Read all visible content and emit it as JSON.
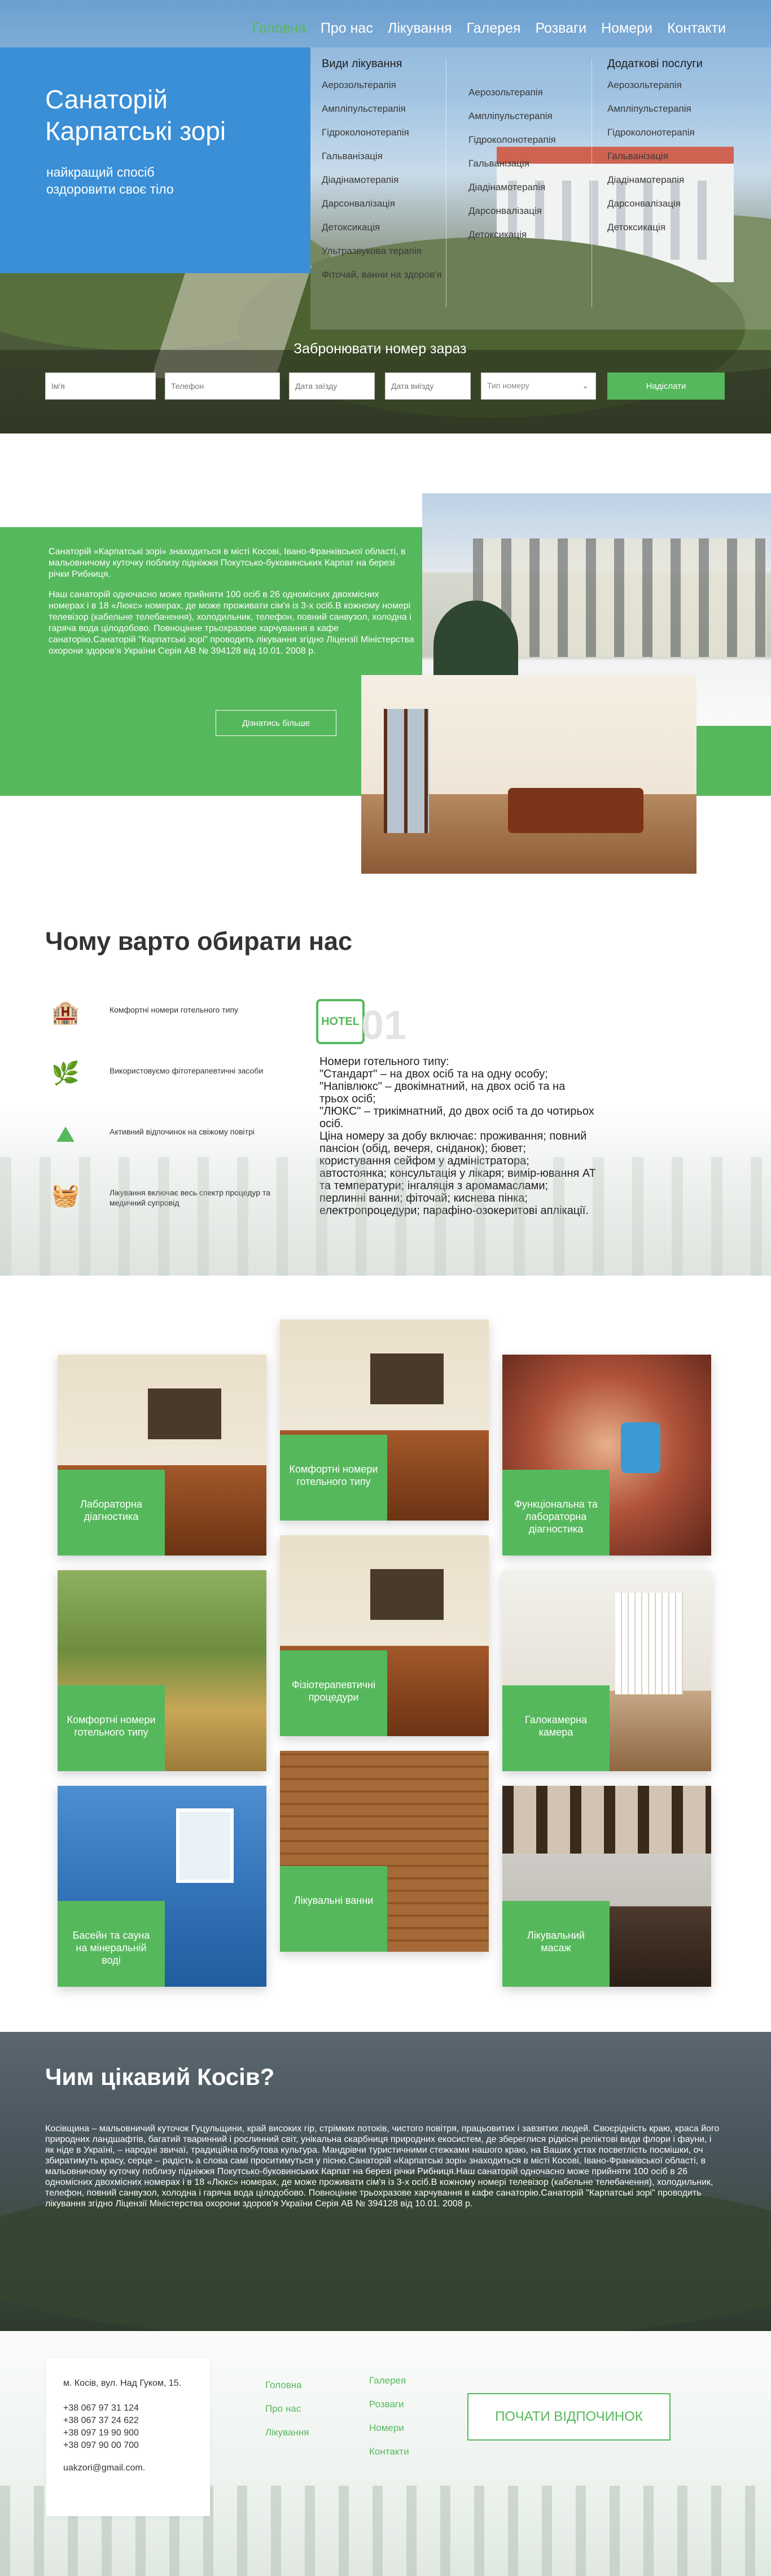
{
  "nav": [
    "Головна",
    "Про нас",
    "Лікування",
    "Галерея",
    "Розваги",
    "Номери",
    "Контакти"
  ],
  "hero": {
    "title": "Санаторій\nКарпатські зорі",
    "subtitle": "найкращий спосіб\nоздоровити своє тіло"
  },
  "treatment_menu": {
    "col1_title": "Види лікування",
    "col1": [
      "Аерозольтерапія",
      "Ампліпульстерапія",
      "Гідроколонотерапія",
      "Гальванізація",
      "Діадінамотерапія",
      "Дарсонвалізація",
      "Детоксикація",
      "Ультразвукова терапія",
      "Фіточай, ванни на здоров'я"
    ],
    "col2": [
      "Аерозольтерапія",
      "Ампліпульстерапія",
      "Гідроколонотерапія",
      "Гальванізація",
      "Діадінамотерапія",
      "Дарсонвалізація",
      "Детоксикація"
    ],
    "col3_title": "Додаткові послуги",
    "col3": [
      "Аерозольтерапія",
      "Ампліпульстерапія",
      "Гідроколонотерапія",
      "Гальванізація",
      "Діадінамотерапія",
      "Дарсонвалізація",
      "Детоксикація"
    ]
  },
  "booking": {
    "title": "Забронювати номер зараз",
    "name_placeholder": "Ім'я",
    "phone_placeholder": "Телефон",
    "date_in_placeholder": "Дата заїзду",
    "date_out_placeholder": "Дата виїзду",
    "type_placeholder": "Тип номеру",
    "submit": "Надіслати"
  },
  "about": {
    "p1": "Санаторій «Карпатські зорі» знаходиться в місті Косові, Івано-Франківської області, в мальовничому куточку поблизу підніжжя Покутсько-буковинських Карпат на березі річки Рибниця.",
    "p2": "Наш санаторій одночасно може прийняти 100 осіб в 26 одномісних двохмісних номерах і в 18 «Люкс» номерах, де може проживати сім'я із 3-х осіб.В кожному номері телевізор (кабельне телебачення), холодильник, телефон, повний санвузол, холодна і гаряча вода цілодобово. Повноцінне трьохразове харчування в кафе санаторію.Санаторій \"Карпатські зорі\" проводить лікування згідно Ліцензії Міністерства охорони здоров'я України Серія АВ № 394128 від 10.01. 2008 р.",
    "button": "Дізнатись більше"
  },
  "why": {
    "title": "Чому варто обирати нас",
    "items": [
      {
        "icon": "hotel-icon",
        "text": "Комфортні номери готельного типу"
      },
      {
        "icon": "leaf-icon",
        "text": "Використовуємо фітотерапевтичні засоби"
      },
      {
        "icon": "mountain-icon",
        "text": "Активний відпочинок на свіжому повітрі"
      },
      {
        "icon": "basket-icon",
        "text": "Лікування включає весь спектр процедур та медичний супровід"
      }
    ],
    "big_icon_label": "HOTEL",
    "number": "01",
    "detail": "Номери готельного типу:\n\"Стандарт\" – на двох осіб та на одну особу;\n\"Напівлюкс\" – двокімнатний, на двох осіб та на трьох осіб;\n\"ЛЮКС\" – трикімнатний, до двох осіб та до чотирьох осіб.\nЦіна номеру за добу включає: проживання; повний пансіон (обід, вечеря, сніданок); бювет; користування сейфом у адміністратора; автостоянка; консультація у лікаря; вимір-ювання АТ та температури; інгаляція з аромамаслами; перлинні ванни; фіточай; киснева пінка; електропроцедури; парафіно-озокеритові аплікації."
  },
  "gallery": [
    "Лабораторна діагностика",
    "Комфортні номери готельного типу",
    "Функціональна та лабораторна діагностика",
    "Комфортні номери готельного типу",
    "Фізіотерапевтичні процедури",
    "Галокамерна камера",
    "Басейн та сауна на мінеральній воді",
    "Лікувальні ванни",
    "Лікувальний масаж"
  ],
  "kosiv": {
    "title": "Чим цікавий Косів?",
    "text": "Косівщина – мальовничий куточок Гуцульщини, край високих гір, стрімких потоків, чистого повітря, працьовитих і завзятих людей. Своєрідність краю, краса його природних ландшафтів, багатий тваринний і рослинний світ, унікальна скарбниця природних екосистем, де збереглися рідкісні реліктові види флори і фауни, і як ніде в Україні, – народні звичаї, традиційна побутова культура. Мандрівчи туристичними стежками нашого краю, на Ваших устах посветлість посмішки, оч збиратимуть красу, серце – радість а слова самі проситимуться у пісню.Санаторій «Карпатські зорі» знаходиться в місті Косові, Івано-Франківської області, в мальовничому куточку поблизу підніжжя Покутсько-буковинських Карпат на березі річки Рибниця.Наш санаторій одночасно може прийняти 100 осіб в 26 одномісних двохмісних номерах і в 18 «Люкс» номерах, де може проживати сім'я із 3-х осіб.В кожному номері телевізор (кабельне телебачення), холодильник, телефон, повний санвузол, холодна і гаряча вода цілодобово. Повноцінне трьохразове харчування в кафе санаторію.Санаторій \"Карпатські зорі\" проводить лікування згідно Ліцензії Міністерства охорони здоров'я України Серія АВ № 394128 від 10.01. 2008 р."
  },
  "footer": {
    "address": "м. Косів, вул. Над Гуком, 15.",
    "phones": [
      "+38 067 97 31 124",
      "+38 067 37 24 622",
      "+38 097 19 90 900",
      "+38 097 90 00 700"
    ],
    "email": "uakzori@gmail.com.",
    "links_col1": [
      "Головна",
      "Про нас",
      "Лікування"
    ],
    "links_col2": [
      "Галерея",
      "Розваги",
      "Номери",
      "Контакти"
    ],
    "cta": "ПОЧАТИ ВІДПОЧИНОК"
  },
  "colors": {
    "accent": "#56b85c",
    "hero_panel": "#3a8fd6"
  }
}
